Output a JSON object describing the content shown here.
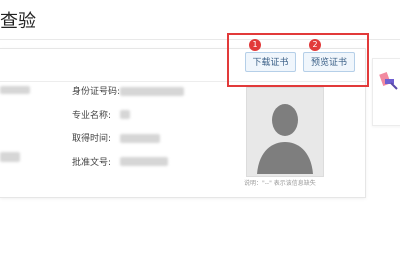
{
  "page": {
    "title": "查验"
  },
  "actions": {
    "download": {
      "step": "1",
      "label": "下载证书"
    },
    "preview": {
      "step": "2",
      "label": "预览证书"
    }
  },
  "fields": [
    {
      "label": "身份证号码:"
    },
    {
      "label": "专业名称:"
    },
    {
      "label": "取得时间:"
    },
    {
      "label": "批准文号:"
    }
  ],
  "photo": {
    "icon": "person-silhouette-icon"
  },
  "note": "说明：\"--\" 表示该信息缺失",
  "side_panel": {
    "icon": "tools-icon"
  },
  "colors": {
    "highlight": "#e23a3a",
    "button_bg": "#f0f6fc",
    "button_border": "#b5cfe8",
    "button_text": "#3a5f86"
  }
}
